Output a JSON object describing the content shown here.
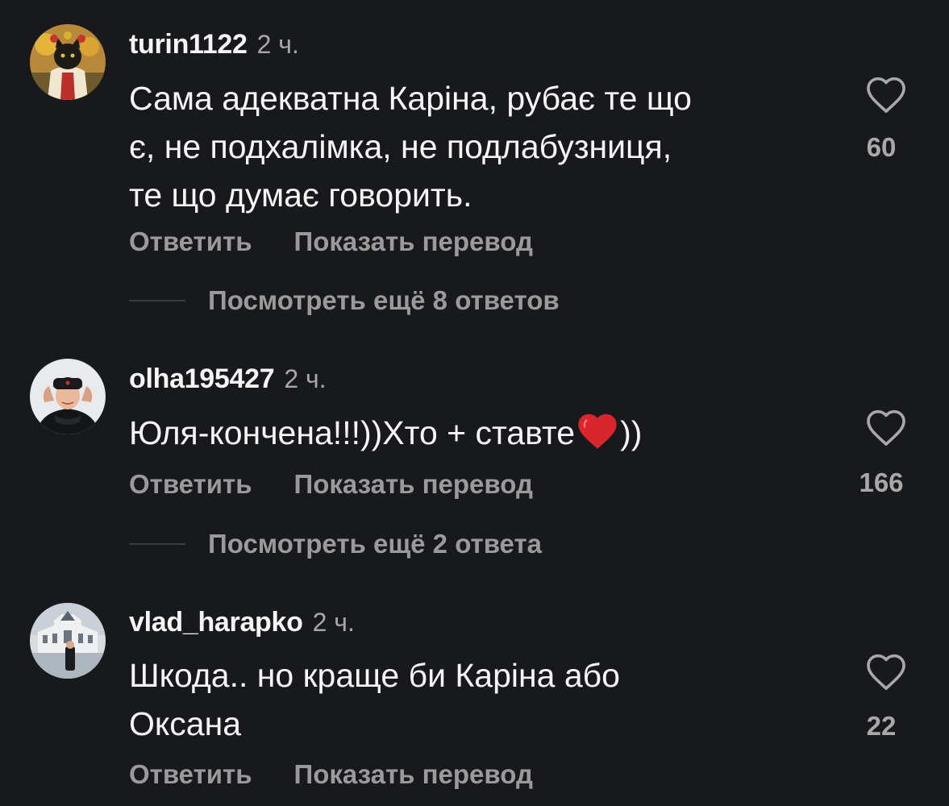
{
  "comments": [
    {
      "username": "turin1122",
      "time": "2 ч.",
      "text": "Сама адекватна Каріна, рубає те що\nє, не подхалімка, не подлабузниця,\nте що думає говорить.",
      "reply_label": "Ответить",
      "translate_label": "Показать перевод",
      "like_count": "60",
      "view_replies": "Посмотреть ещё 8 ответов"
    },
    {
      "username": "olha195427",
      "time": "2 ч.",
      "text_before_emoji": "Юля-кончена!!!))Хто + ставте",
      "text_after_emoji": "))",
      "reply_label": "Ответить",
      "translate_label": "Показать перевод",
      "like_count": "166",
      "view_replies": "Посмотреть ещё 2 ответа"
    },
    {
      "username": "vlad_harapko",
      "time": "2 ч.",
      "text": "Шкода.. но краще би Каріна або\nОксана",
      "reply_label": "Ответить",
      "translate_label": "Показать перевод",
      "like_count": "22"
    }
  ],
  "colors": {
    "background": "#17191c",
    "text": "#f5f5f5",
    "secondary": "#9a9a9a",
    "heart_emoji": "#d9262c"
  },
  "icons": {
    "like": "heart-outline-icon",
    "emoji": "red-heart-emoji"
  }
}
